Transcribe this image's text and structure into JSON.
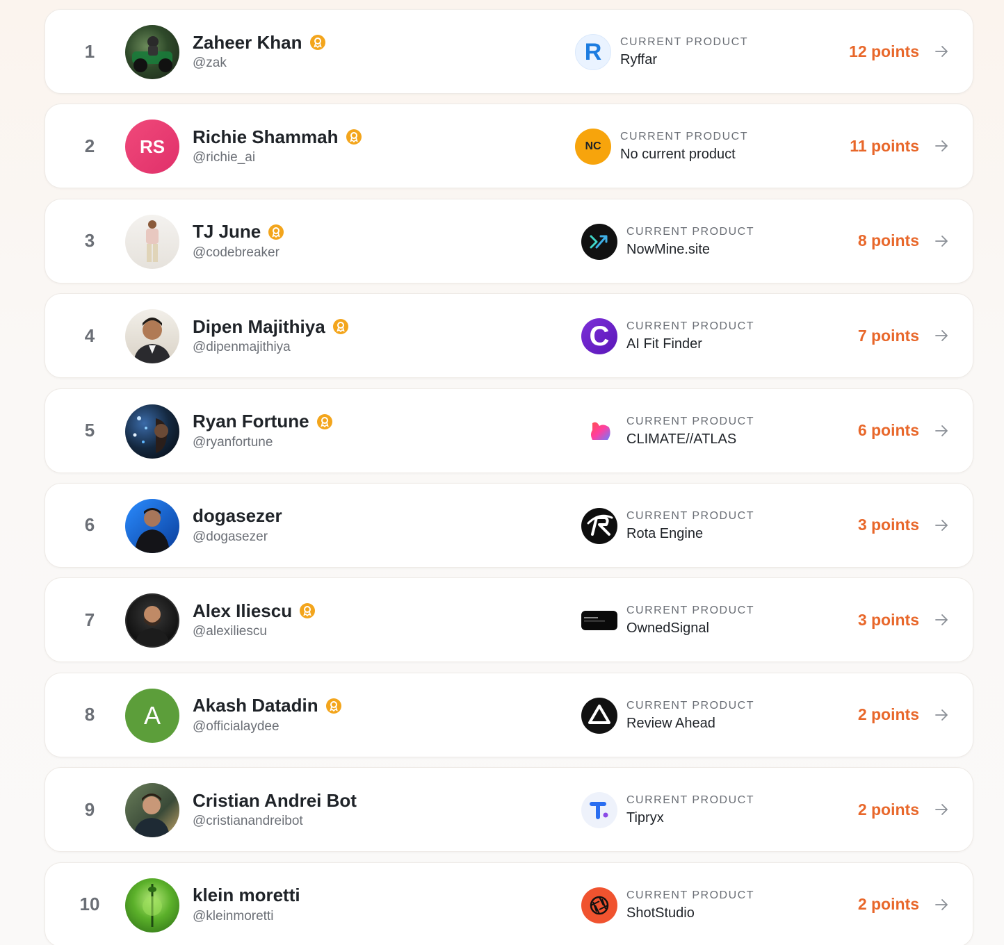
{
  "product_label": "CURRENT PRODUCT",
  "colors": {
    "accent": "#e8672a",
    "badge": "#f3a51c"
  },
  "rows": [
    {
      "rank": "1",
      "name": "Zaheer Khan",
      "handle": "@zak",
      "verified": true,
      "product": "Ryffar",
      "product_icon": "ryffar-logo-icon",
      "points": "12 points"
    },
    {
      "rank": "2",
      "name": "Richie Shammah",
      "handle": "@richie_ai",
      "verified": true,
      "initials": "RS",
      "product": "No current product",
      "product_initials": "NC",
      "points": "11 points"
    },
    {
      "rank": "3",
      "name": "TJ June",
      "handle": "@codebreaker",
      "verified": true,
      "product": "NowMine.site",
      "product_icon": "nowmine-logo-icon",
      "points": "8 points"
    },
    {
      "rank": "4",
      "name": "Dipen Majithiya",
      "handle": "@dipenmajithiya",
      "verified": true,
      "product": "AI Fit Finder",
      "product_icon": "ai-fit-finder-logo-icon",
      "points": "7 points"
    },
    {
      "rank": "5",
      "name": "Ryan Fortune",
      "handle": "@ryanfortune",
      "verified": true,
      "product": "CLIMATE//ATLAS",
      "product_icon": "climate-atlas-logo-icon",
      "points": "6 points"
    },
    {
      "rank": "6",
      "name": "dogasezer",
      "handle": "@dogasezer",
      "verified": false,
      "product": "Rota Engine",
      "product_icon": "rota-engine-logo-icon",
      "points": "3 points"
    },
    {
      "rank": "7",
      "name": "Alex Iliescu",
      "handle": "@alexiliescu",
      "verified": true,
      "product": "OwnedSignal",
      "product_icon": "ownedsignal-logo-icon",
      "points": "3 points"
    },
    {
      "rank": "8",
      "name": "Akash Datadin",
      "handle": "@officialaydee",
      "verified": true,
      "initials": "A",
      "product": "Review Ahead",
      "product_icon": "review-ahead-logo-icon",
      "points": "2 points"
    },
    {
      "rank": "9",
      "name": "Cristian Andrei Bot",
      "handle": "@cristianandreibot",
      "verified": false,
      "product": "Tipryx",
      "product_icon": "tipryx-logo-icon",
      "points": "2 points"
    },
    {
      "rank": "10",
      "name": "klein moretti",
      "handle": "@kleinmoretti",
      "verified": false,
      "product": "ShotStudio",
      "product_icon": "shotstudio-logo-icon",
      "points": "2 points"
    }
  ]
}
